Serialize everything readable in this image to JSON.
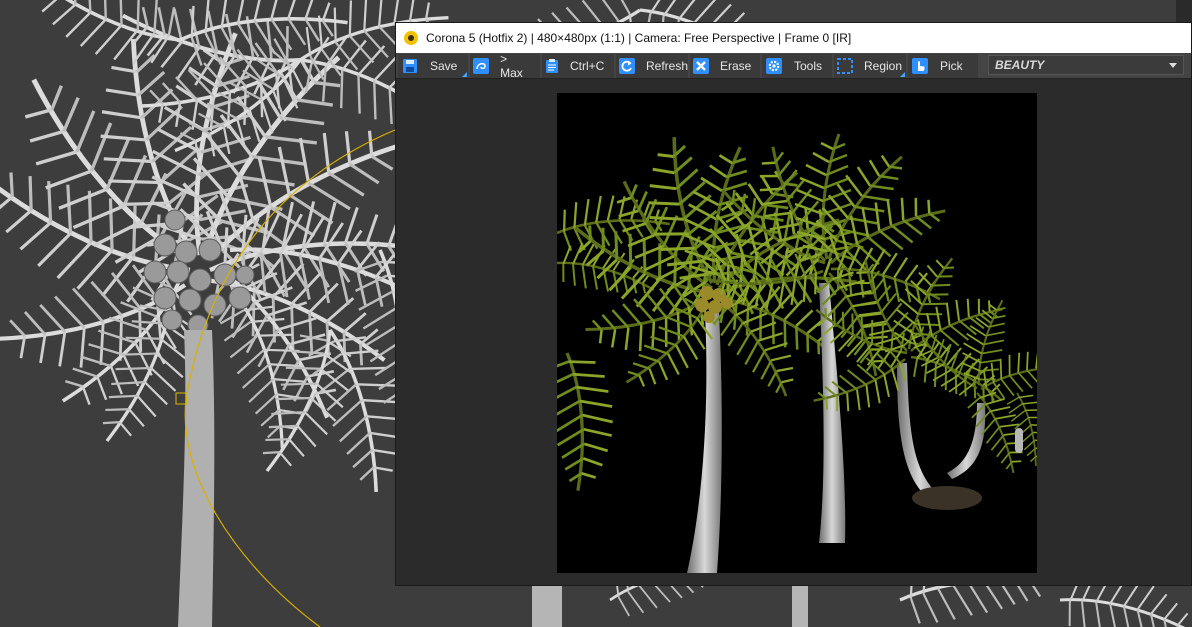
{
  "vfb": {
    "title": "Corona 5 (Hotfix 2) | 480×480px (1:1) | Camera: Free Perspective | Frame 0 [IR]",
    "toolbar": {
      "save": "Save",
      "to_max": "> Max",
      "copy": "Ctrl+C",
      "refresh": "Refresh",
      "erase": "Erase",
      "tools": "Tools",
      "region": "Region",
      "pick": "Pick"
    },
    "render_pass": "BEAUTY",
    "icons": {
      "logo": "corona-logo-icon",
      "save": "floppy-disk-icon",
      "to_max": "max-logo-icon",
      "copy": "clipboard-icon",
      "refresh": "refresh-icon",
      "erase": "x-icon",
      "tools": "gear-icon",
      "region": "dashed-square-icon",
      "pick": "hand-pointer-icon"
    },
    "colors": {
      "accent": "#2f8fff",
      "titlebar": "#ffffff",
      "toolbar": "#444444",
      "canvas": "#2b2b2b"
    }
  },
  "viewport": {
    "background": "#3d3d3d"
  }
}
